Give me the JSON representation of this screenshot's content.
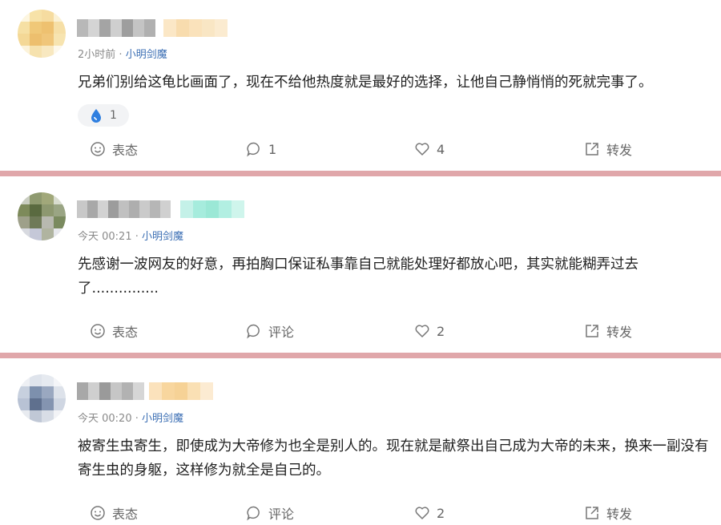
{
  "comments": [
    {
      "time": "2小时前",
      "source": "小明剑魔",
      "text": "兄弟们别给这龟比画面了，现在不给他热度就是最好的选择，让他自己静悄悄的死就完事了。",
      "reaction_count": "1",
      "actions": {
        "react": "表态",
        "comment": "1",
        "like": "4",
        "share": "转发"
      }
    },
    {
      "time": "今天 00:21",
      "source": "小明剑魔",
      "text": "先感谢一波网友的好意，再拍胸口保证私事靠自己就能处理好都放心吧，其实就能糊弄过去了...............",
      "actions": {
        "react": "表态",
        "comment": "评论",
        "like": "2",
        "share": "转发"
      }
    },
    {
      "time": "今天 00:20",
      "source": "小明剑魔",
      "text": "被寄生虫寄生，即使成为大帝修为也全是别人的。现在就是献祭出自己成为大帝的未来，换来一副没有寄生虫的身躯，这样修为就全是自己的。",
      "actions": {
        "react": "表态",
        "comment": "评论",
        "like": "2",
        "share": "转发"
      }
    }
  ],
  "colors": {
    "divider": "#e0a7aa",
    "source_link": "#3c6fb4",
    "reaction_icon": "#2f7fe0"
  },
  "icons": [
    "emoji-icon",
    "comment-icon",
    "heart-icon",
    "share-icon",
    "water-drop-icon"
  ]
}
